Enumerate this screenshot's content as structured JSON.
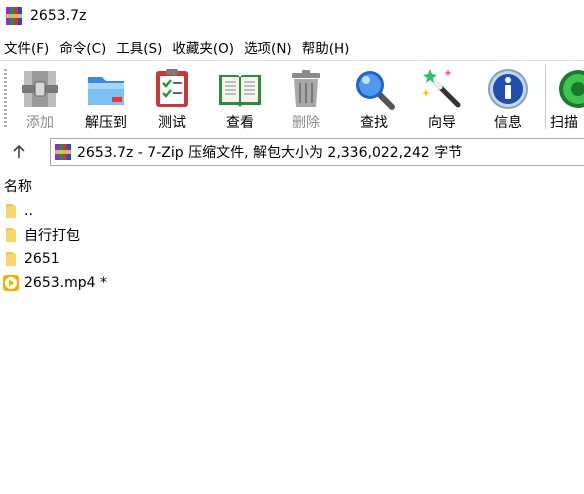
{
  "window": {
    "title": "2653.7z"
  },
  "menu": [
    {
      "label": "文件(F)"
    },
    {
      "label": "命令(C)"
    },
    {
      "label": "工具(S)"
    },
    {
      "label": "收藏夹(O)"
    },
    {
      "label": "选项(N)"
    },
    {
      "label": "帮助(H)"
    }
  ],
  "toolbar": {
    "add": {
      "label": "添加",
      "icon": "archive-add-icon",
      "enabled": false
    },
    "extract": {
      "label": "解压到",
      "icon": "folder-extract-icon"
    },
    "test": {
      "label": "测试",
      "icon": "clipboard-check-icon"
    },
    "view": {
      "label": "查看",
      "icon": "open-book-icon"
    },
    "delete": {
      "label": "删除",
      "icon": "trash-can-icon",
      "enabled": false
    },
    "find": {
      "label": "查找",
      "icon": "magnifier-icon"
    },
    "wizard": {
      "label": "向导",
      "icon": "magic-wand-icon"
    },
    "info": {
      "label": "信息",
      "icon": "info-icon"
    },
    "scan": {
      "label": "扫描",
      "icon": "virus-scan-icon"
    }
  },
  "address": {
    "text": "2653.7z - 7-Zip 压缩文件, 解包大小为 2,336,022,242 字节"
  },
  "list": {
    "column_name": "名称",
    "items": [
      {
        "name": "..",
        "type": "parent-folder"
      },
      {
        "name": "自行打包",
        "type": "folder"
      },
      {
        "name": "2651",
        "type": "folder"
      },
      {
        "name": "2653.mp4 *",
        "type": "video"
      }
    ]
  },
  "colors": {
    "folder": "#f3c94f",
    "video": "#f0b400",
    "accent": "#1e63c8"
  }
}
